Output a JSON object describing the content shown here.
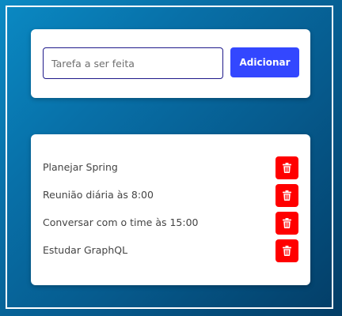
{
  "form": {
    "input_placeholder": "Tarefa a ser feita",
    "input_value": "",
    "add_label": "Adicionar"
  },
  "tasks": [
    {
      "label": "Planejar Spring"
    },
    {
      "label": "Reunião diária às 8:00"
    },
    {
      "label": "Conversar com o time às 15:00"
    },
    {
      "label": "Estudar GraphQL"
    }
  ],
  "icons": {
    "delete": "trash-icon"
  },
  "colors": {
    "accent": "#3347ff",
    "danger": "#ff0000",
    "input_border": "#1f1a8a",
    "background_start": "#0a8ac4",
    "background_end": "#033d66"
  }
}
